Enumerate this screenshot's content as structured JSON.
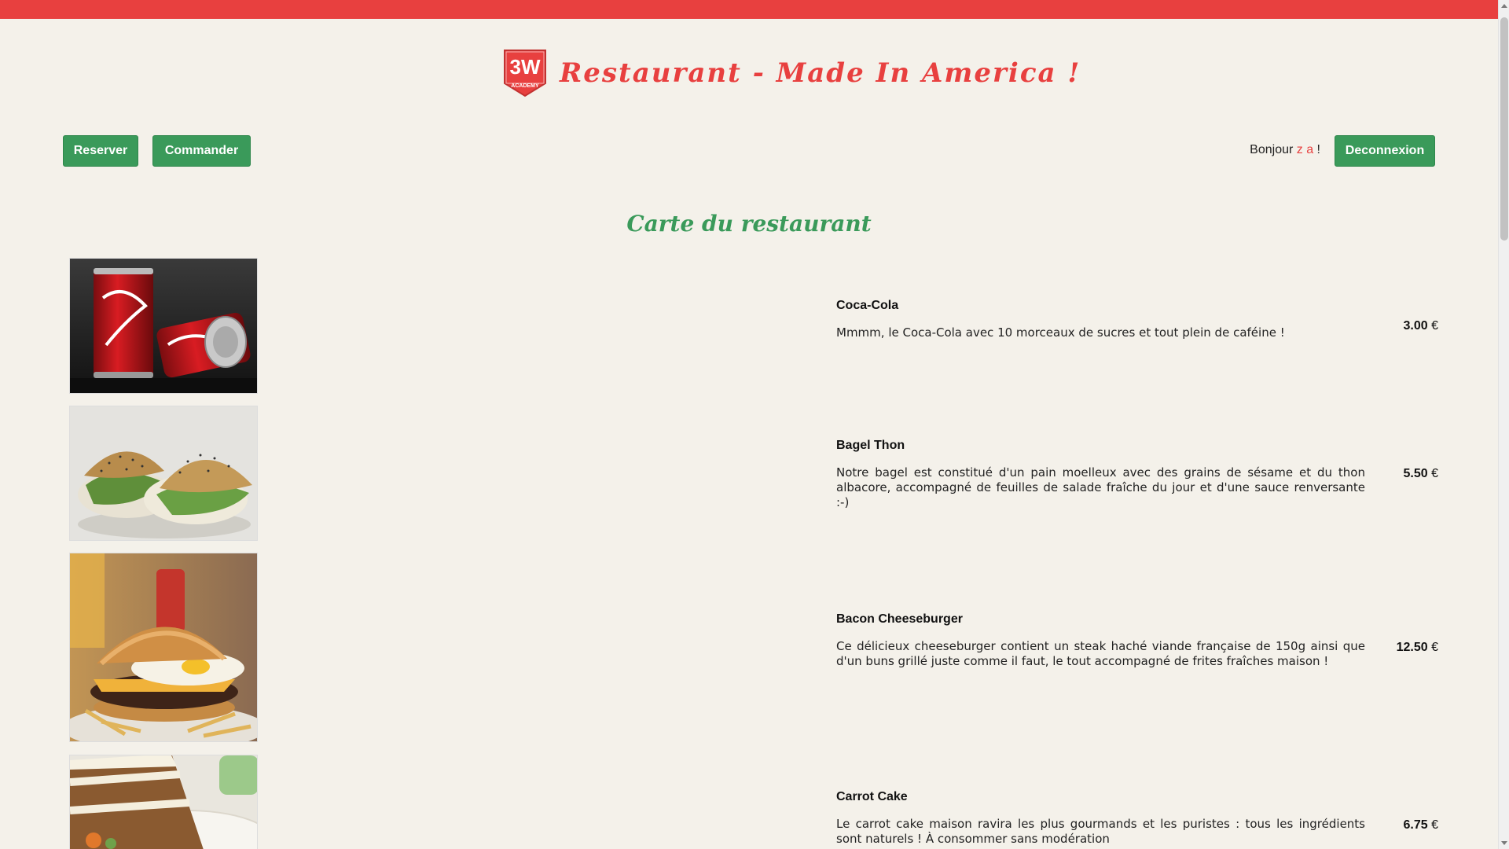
{
  "header": {
    "logo_text": "3W",
    "logo_subtext": "ACADEMY",
    "title": "Restaurant - Made In America !"
  },
  "nav": {
    "reserve_label": "Reserver",
    "order_label": "Commander",
    "greeting_prefix": "Bonjour ",
    "username": "z a",
    "greeting_suffix": " !",
    "logout_label": "Deconnexion"
  },
  "menu": {
    "title": "Carte du restaurant",
    "currency": "€",
    "items": [
      {
        "name": "Coca-Cola",
        "description": "Mmmm, le Coca-Cola avec 10 morceaux de sucres et tout plein de caféine !",
        "price": "3.00",
        "image_icon": "cola-cans-photo"
      },
      {
        "name": "Bagel Thon",
        "description": "Notre bagel est constitué d'un pain moelleux avec des grains de sésame et du thon albacore, accompagné de feuilles de salade fraîche du jour et d'une sauce renversante :-)",
        "price": "5.50",
        "image_icon": "bagel-photo"
      },
      {
        "name": "Bacon Cheeseburger",
        "description": "Ce délicieux cheeseburger contient un steak haché viande française de 150g ainsi que d'un buns grillé juste comme il faut, le tout accompagné de frites fraîches maison !",
        "price": "12.50",
        "image_icon": "burger-photo"
      },
      {
        "name": "Carrot Cake",
        "description": "Le carrot cake maison ravira les plus gourmands et les puristes : tous les ingrédients sont naturels ! À consommer sans modération",
        "price": "6.75",
        "image_icon": "carrot-cake-photo"
      }
    ]
  },
  "colors": {
    "accent_red": "#e8403f",
    "accent_green": "#3a9a5a",
    "background": "#f4f1ea"
  }
}
